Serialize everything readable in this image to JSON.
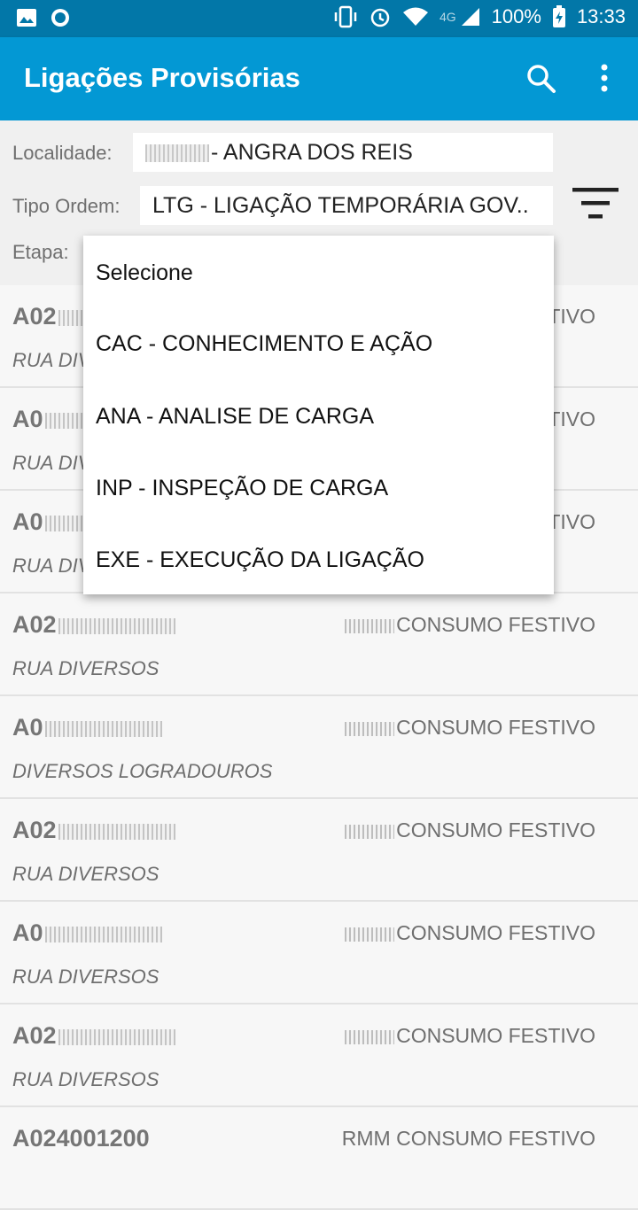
{
  "status_bar": {
    "battery": "100%",
    "time": "13:33",
    "network": "4G"
  },
  "app_bar": {
    "title": "Ligações Provisórias",
    "search_icon": "search-icon",
    "more_icon": "more-vert-icon"
  },
  "filters": {
    "localidade_label": "Localidade:",
    "localidade_value": "- ANGRA DOS REIS",
    "tipo_ordem_label": "Tipo Ordem:",
    "tipo_ordem_value": "LTG - LIGAÇÃO TEMPORÁRIA GOV..",
    "etapa_label": "Etapa:",
    "filter_icon": "filter-icon"
  },
  "dropdown": {
    "options": [
      "Selecione",
      "CAC - CONHECIMENTO E AÇÃO",
      "ANA - ANALISE DE CARGA",
      "INP - INSPEÇÃO DE CARGA",
      "EXE - EXECUÇÃO DA LIGAÇÃO"
    ]
  },
  "list": {
    "rows": [
      {
        "code": "A02",
        "type": "TIVO",
        "address": "RUA DIV"
      },
      {
        "code": "A0",
        "type": "TIVO",
        "address": "RUA DIV"
      },
      {
        "code": "A0",
        "type": "TIVO",
        "address": "RUA DIV"
      },
      {
        "code": "A02",
        "type": "CONSUMO FESTIVO",
        "address": "RUA DIVERSOS"
      },
      {
        "code": "A0",
        "type": "CONSUMO FESTIVO",
        "address": "DIVERSOS LOGRADOUROS"
      },
      {
        "code": "A02",
        "type": "CONSUMO FESTIVO",
        "address": "RUA DIVERSOS"
      },
      {
        "code": "A0",
        "type": "CONSUMO FESTIVO",
        "address": "RUA DIVERSOS"
      },
      {
        "code": "A02",
        "type": "CONSUMO FESTIVO",
        "address": "RUA DIVERSOS"
      },
      {
        "code": "A024001200",
        "type": "RMM CONSUMO FESTIVO",
        "address": ""
      }
    ]
  }
}
